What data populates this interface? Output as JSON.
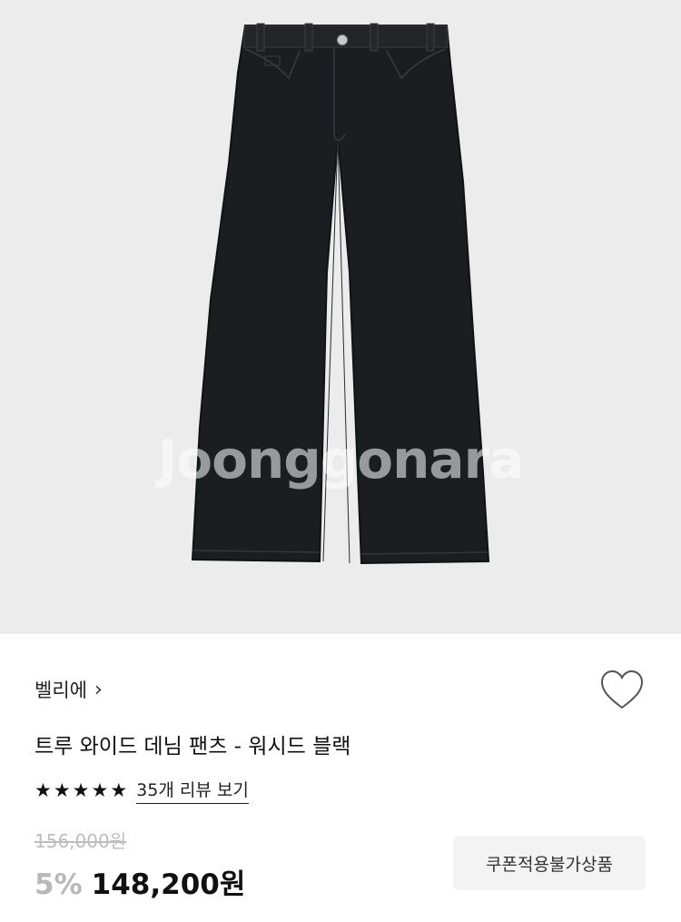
{
  "product_image": {
    "alt": "트루 와이드 데님 팬츠 - 워시드 블랙",
    "watermark": "Joonggonara"
  },
  "brand": {
    "name": "벨리에",
    "chevron": "chevron-right-icon"
  },
  "wishlist": {
    "icon": "heart-outline-icon"
  },
  "product": {
    "title": "트루 와이드 데님 팬츠 - 워시드 블랙"
  },
  "rating": {
    "stars": 5,
    "review_text": "35개 리뷰 보기"
  },
  "pricing": {
    "original_price": "156,000원",
    "discount": "5%",
    "sale_price": "148,200원"
  },
  "coupon": {
    "label": "쿠폰적용불가상품"
  },
  "colors": {
    "hero_background": "#ececec",
    "denim": "#1c1d20",
    "discount": "#b8b8b8",
    "coupon_bg": "#f3f3f3"
  }
}
